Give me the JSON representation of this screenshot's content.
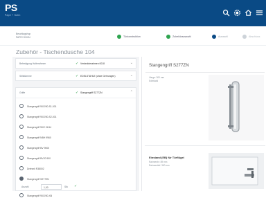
{
  "brand": {
    "logo_text": "PS",
    "tagline": "Pape + Sohn"
  },
  "header": {
    "icons": [
      "search-icon",
      "settings-icon",
      "home-icon",
      "menu-icon"
    ],
    "bg_color": "#0a4a85"
  },
  "breadcrumb": {
    "line1": "Beschlagshop",
    "line2": "PAPE+SOHN"
  },
  "steps": [
    {
      "label": "Türkonstruktion",
      "state": "done"
    },
    {
      "label": "Zubehörauswahl",
      "state": "done"
    },
    {
      "label": "Auswahl",
      "state": "active"
    },
    {
      "label": "Abschluss",
      "state": "pending"
    }
  ],
  "page_title": "Zubehör - Tischendusche 104",
  "selections": [
    {
      "key": "Befestigung Halterahmen",
      "value": "Verdeckterahmen 0018"
    },
    {
      "key": "Stiltstämme",
      "value": "EDELSTAHLE (ohne Gehrungen)"
    },
    {
      "key": "Griffe",
      "value": "Stangengriff S277ZN"
    }
  ],
  "options": [
    {
      "label": "Stangengriff 90/2/50-S1-001",
      "selected": false
    },
    {
      "label": "Stangengriff 90/2/50-S2-001",
      "selected": false
    },
    {
      "label": "Stangengriff 90/2 24/14",
      "selected": false
    },
    {
      "label": "Stangengriff NBH 9960",
      "selected": false
    },
    {
      "label": "Stangengriff BV 9000",
      "selected": false
    },
    {
      "label": "Stangengriff BV20 900",
      "selected": false
    },
    {
      "label": "Drehmit R38002",
      "selected": false
    },
    {
      "label": "Stangengriff S277ZN",
      "selected": true
    },
    {
      "label": "Stangengriff 90/2/50-XB",
      "selected": false
    }
  ],
  "quantity": {
    "label": "Anzahl",
    "value": "1,00",
    "unit": "Stk"
  },
  "product": {
    "title": "Stangengriff S277ZN",
    "specs": [
      "Länge: 300 mm",
      "Edelstahl"
    ],
    "secondary_title": "Einstand (EB) für Türflügel",
    "secondary_specs": [
      "Rahmenbr: 89 mm",
      "Rahmentief: 300 mm"
    ]
  }
}
